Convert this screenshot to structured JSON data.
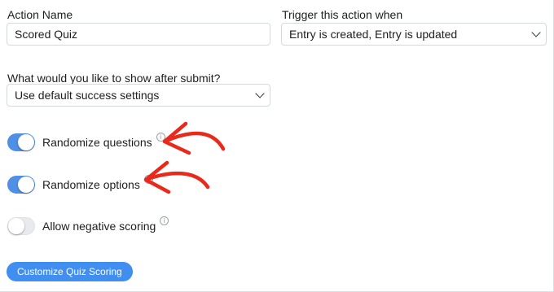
{
  "form": {
    "action_name_label": "Action Name",
    "action_name_value": "Scored Quiz",
    "trigger_label": "Trigger this action when",
    "trigger_value": "Entry is created, Entry is updated",
    "after_submit_label": "What would you like to show after submit?",
    "after_submit_value": "Use default success settings"
  },
  "toggles": [
    {
      "label": "Randomize questions",
      "on": true,
      "info_icon": "info-circle-icon"
    },
    {
      "label": "Randomize options",
      "on": true,
      "info_icon": "info-circle-icon"
    },
    {
      "label": "Allow negative scoring",
      "on": false,
      "info_icon": "info-circle-icon"
    }
  ],
  "button": {
    "label": "Customize Quiz Scoring"
  },
  "colors": {
    "accent": "#3f8ef0",
    "toggle_on": "#4f8fe6",
    "annotation_arrow": "#e8291c"
  }
}
